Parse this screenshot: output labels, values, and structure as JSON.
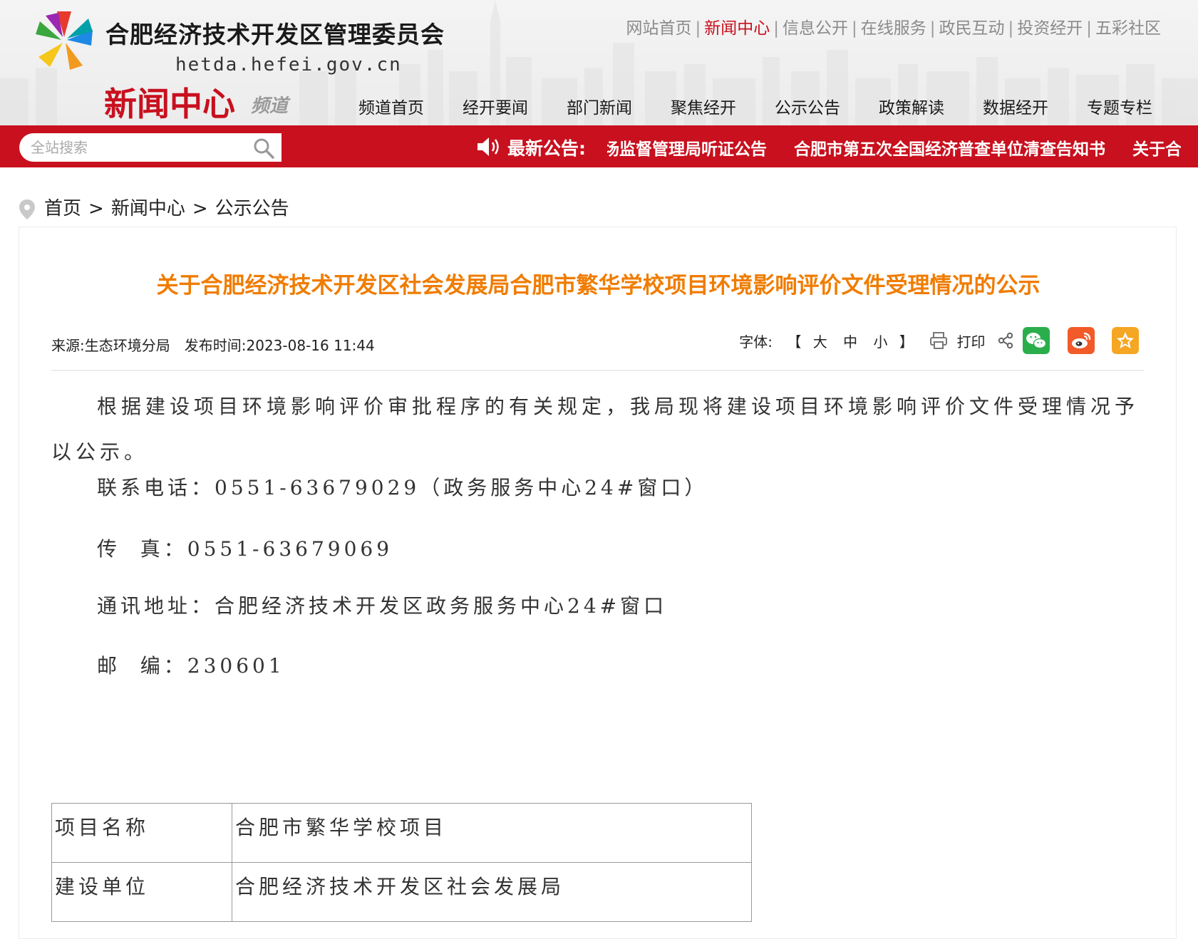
{
  "header": {
    "site_name": "合肥经济技术开发区管理委员会",
    "domain": "hetda.hefei.gov.cn",
    "channel_title": "新闻中心",
    "channel_suffix": "频道",
    "top_links": [
      "网站首页",
      "新闻中心",
      "信息公开",
      "在线服务",
      "政民互动",
      "投资经开",
      "五彩社区"
    ],
    "top_links_separator": "|",
    "active_top_link": "新闻中心",
    "main_nav": [
      "频道首页",
      "经开要闻",
      "部门新闻",
      "聚焦经开",
      "公示公告",
      "政策解读",
      "数据经开",
      "专题专栏"
    ]
  },
  "search": {
    "placeholder": "全站搜索"
  },
  "notice": {
    "label": "最新公告:",
    "items": [
      "场监督管理局听证公告",
      "合肥市第五次全国经济普查单位清查告知书",
      "关于合肥"
    ]
  },
  "breadcrumb": {
    "home": "首页",
    "sep": ">",
    "level1": "新闻中心",
    "level2": "公示公告"
  },
  "article": {
    "title": "关于合肥经济技术开发区社会发展局合肥市繁华学校项目环境影响评价文件受理情况的公示",
    "source_label": "来源:",
    "source": "生态环境分局",
    "date_label": "发布时间:",
    "date": "2023-08-16 11:44",
    "font_label": "字体:",
    "bracket_open": "【",
    "bracket_close": "】",
    "font_sizes": [
      "大",
      "中",
      "小"
    ],
    "print_label": "打印",
    "intro": "根据建设项目环境影响评价审批程序的有关规定，我局现将建设项目环境影响评价文件受理情况予以公示。",
    "contact_lines": [
      "联系电话：0551-63679029（政务服务中心24#窗口）",
      "传  真：0551-63679069",
      "通讯地址：合肥经济技术开发区政务服务中心24#窗口",
      "邮  编：230601"
    ],
    "table": [
      {
        "key": "项目名称",
        "value": "合肥市繁华学校项目"
      },
      {
        "key": "建设单位",
        "value": "合肥经济技术开发区社会发展局"
      }
    ]
  },
  "colors": {
    "brand_red": "#c8101e",
    "title_orange": "#f07c00",
    "wechat_green": "#2aae4b",
    "weibo_orange": "#f25a29",
    "favorite_orange": "#f5a623"
  },
  "icons": [
    "logo-icon",
    "search-icon",
    "speaker-icon",
    "location-pin-icon",
    "print-icon",
    "share-icon",
    "wechat-icon",
    "weibo-icon",
    "favorite-star-icon"
  ]
}
